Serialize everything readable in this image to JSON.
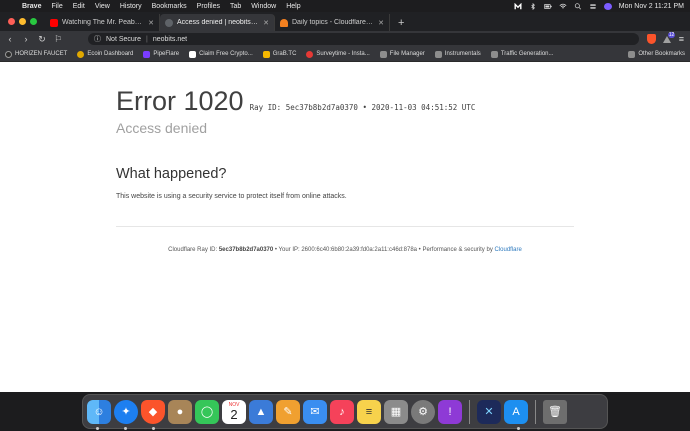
{
  "menubar": {
    "app_name": "Brave",
    "items": [
      "File",
      "Edit",
      "View",
      "History",
      "Bookmarks",
      "Profiles",
      "Tab",
      "Window",
      "Help"
    ],
    "clock": "Mon Nov 2  11:21 PM"
  },
  "tabs": [
    {
      "title": "Watching The Mr. Peabody &",
      "color": "#ff0000",
      "active": false
    },
    {
      "title": "Access denied | neobits.net use",
      "color": "#5f6368",
      "active": true
    },
    {
      "title": "Daily topics - Cloudflare Commu",
      "color": "#f38020",
      "active": false
    }
  ],
  "toolbar": {
    "security": "Not Secure",
    "url": "neobits.net",
    "badge": "12"
  },
  "bookmarks": [
    {
      "label": "HORIZEN FAUCET",
      "color": "#2b2b2b"
    },
    {
      "label": "Ecoin Dashboard",
      "color": "#e0a800"
    },
    {
      "label": "PipeFlare",
      "color": "#7a3cff"
    },
    {
      "label": "Claim Free Crypto...",
      "color": "#ffffff"
    },
    {
      "label": "GraB.TC",
      "color": "#f5b700"
    },
    {
      "label": "Surveytime - Insta...",
      "color": "#e53935"
    },
    {
      "label": "File Manager",
      "color": "#8d8d8d"
    },
    {
      "label": "Instrumentals",
      "color": "#8d8d8d"
    },
    {
      "label": "Traffic Generation...",
      "color": "#8d8d8d"
    }
  ],
  "other_bookmarks": "Other Bookmarks",
  "page": {
    "error_title": "Error 1020",
    "ray_line": "Ray ID: 5ec37b8b2d7a0370 • 2020-11-03 04:51:52 UTC",
    "subtitle": "Access denied",
    "what_heading": "What happened?",
    "description": "This website is using a security service to protect itself from online attacks.",
    "footer": {
      "ray_label": "Cloudflare Ray ID:",
      "ray_id": "5ec37b8b2d7a0370",
      "ip_text": "• Your IP: 2600:6c40:6b80:2a39:fd0a:2a11:c46d:878a •",
      "perf_text": "Performance & security by",
      "link": "Cloudflare"
    }
  },
  "dock": {
    "calendar_month": "NOV",
    "calendar_day": "2",
    "apps": [
      {
        "name": "finder",
        "color": "#3d8fe6"
      },
      {
        "name": "safari",
        "color": "#1d7ff0"
      },
      {
        "name": "brave",
        "color": "#fb542b"
      },
      {
        "name": "contacts",
        "color": "#a88558"
      },
      {
        "name": "messages",
        "color": "#35c659"
      },
      {
        "name": "calendar",
        "color": "#ffffff"
      },
      {
        "name": "keynote",
        "color": "#3b7bd8"
      },
      {
        "name": "pages",
        "color": "#f0a030"
      },
      {
        "name": "mail",
        "color": "#3a8ef0"
      },
      {
        "name": "music",
        "color": "#f5425a"
      },
      {
        "name": "notes",
        "color": "#f7d24c"
      },
      {
        "name": "launchpad",
        "color": "#8b8b8b"
      },
      {
        "name": "system-preferences",
        "color": "#7a7a7a"
      },
      {
        "name": "feedback",
        "color": "#8e3ad6"
      },
      {
        "name": "exodus",
        "color": "#1d2a5a"
      },
      {
        "name": "app-store",
        "color": "#1d8ff0"
      },
      {
        "name": "trash",
        "color": "#6e6e6e"
      }
    ]
  }
}
